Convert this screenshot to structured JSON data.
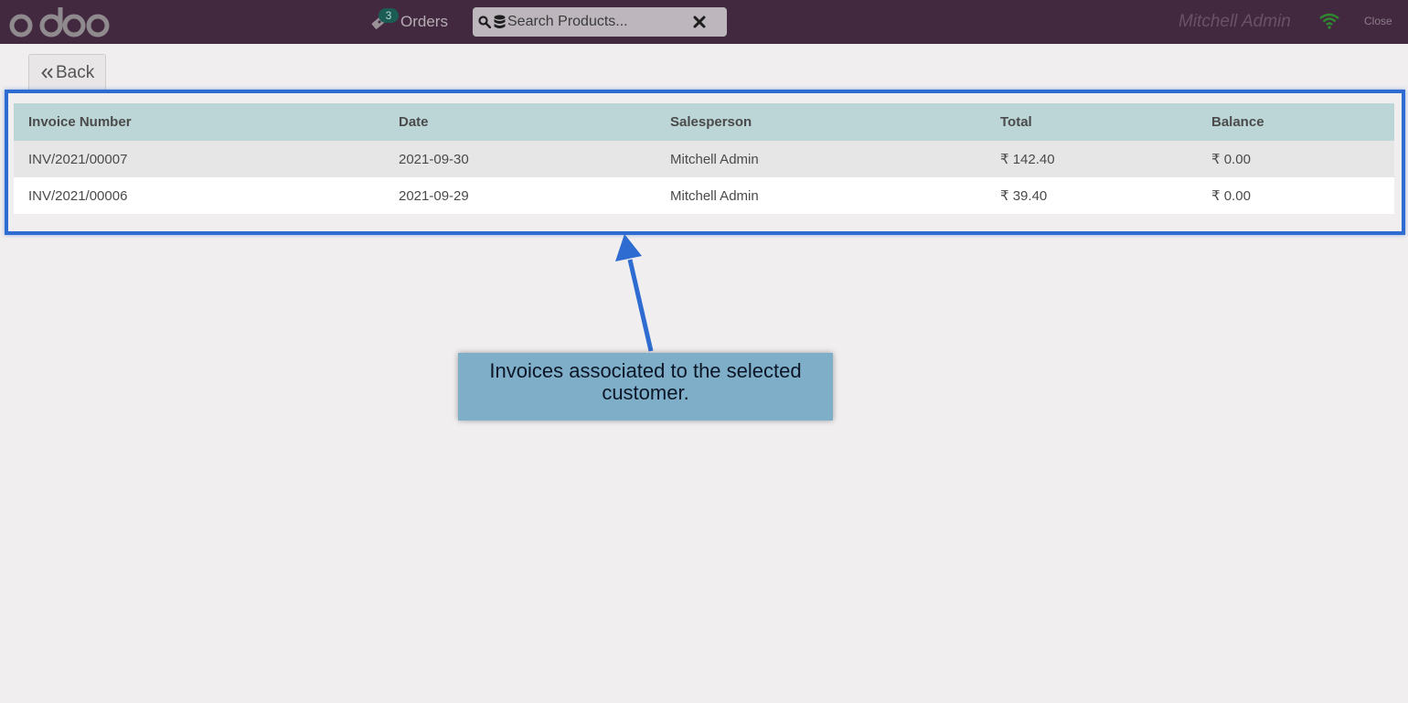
{
  "header": {
    "logo_text": "odoo",
    "orders_label": "Orders",
    "orders_count": "3",
    "search_placeholder": "Search Products...",
    "user_name": "Mitchell Admin",
    "close_label": "Close"
  },
  "back_label": "Back",
  "invoices": {
    "columns": [
      "Invoice Number",
      "Date",
      "Salesperson",
      "Total",
      "Balance"
    ],
    "rows": [
      {
        "number": "INV/2021/00007",
        "date": "2021-09-30",
        "salesperson": "Mitchell Admin",
        "total": "₹ 142.40",
        "balance": "₹ 0.00"
      },
      {
        "number": "INV/2021/00006",
        "date": "2021-09-29",
        "salesperson": "Mitchell Admin",
        "total": "₹ 39.40",
        "balance": "₹ 0.00"
      }
    ]
  },
  "annotation": {
    "text": "Invoices associated to the selected customer."
  },
  "colors": {
    "topbar": "#43293f",
    "table_header": "#bcd5d7",
    "highlight": "#2e6cd1",
    "callout": "#7eaec8",
    "wifi": "#2f8a2f"
  },
  "icons": [
    "ticket-icon",
    "search-icon",
    "database-icon",
    "clear-icon",
    "wifi-icon",
    "double-chevron-left-icon"
  ]
}
